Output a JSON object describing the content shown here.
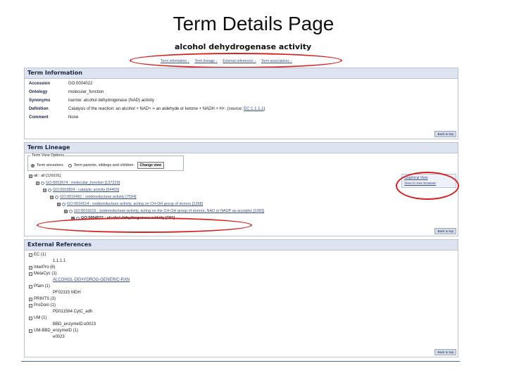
{
  "slide_title": "Term Details Page",
  "term_title": "alcohol dehydrogenase activity",
  "jump_links": [
    "Term information ↓",
    "Term lineage ↓",
    "External references ↓",
    "Term associations ↓"
  ],
  "back_to_top": "Back to top",
  "term_information": {
    "header": "Term Information",
    "rows": [
      {
        "key": "Accession",
        "value": "GO:0004022"
      },
      {
        "key": "Ontology",
        "value": "molecular_function"
      },
      {
        "key": "Synonyms",
        "value": "narrow: alcohol dehydrogenase (NAD) activity"
      },
      {
        "key": "Definition",
        "value": "Catalysis of the reaction: an alcohol + NAD+ = an aldehyde or ketone + NADH + H+. (source: ",
        "link": "EC:1.1.1.1",
        "suffix": ")"
      },
      {
        "key": "Comment",
        "value": "None"
      }
    ]
  },
  "term_lineage": {
    "header": "Term Lineage",
    "view_options": {
      "legend": "Term View Options",
      "option1": "Term ancestors",
      "option2": "Term parents, siblings and children",
      "button": "Change view"
    },
    "tree": [
      {
        "toggle": "⊟",
        "text": "all : all [129191]"
      },
      {
        "toggle": "⊟",
        "text": "GO:0003674 : molecular_function [137229]"
      },
      {
        "toggle": "⊟",
        "text": "GO:0003824 : catalytic activity [64400]"
      },
      {
        "toggle": "⊟",
        "text": "GO:0016491 : oxidoreductase activity [7594]"
      },
      {
        "toggle": "⊞",
        "text": "GO:0016614 : oxidoreductase activity, acting on CH-OH group of donors [1268]"
      },
      {
        "toggle": "⊞",
        "text": "GO:0016616 : oxidoreductase activity, acting on the CH-OH group of donors, NAD or NADP as acceptor [1083]"
      },
      {
        "toggle": "⊞",
        "text": "GO:0004022 : alcohol dehydrogenase activity [191]"
      }
    ],
    "views": [
      "Graphical View",
      "View in tree browser"
    ]
  },
  "external_references": {
    "header": "External References",
    "items": [
      {
        "db": "EC (1)",
        "sub": "1.1.1.1"
      },
      {
        "db": "InterPro (6)",
        "sub": ""
      },
      {
        "db": "MetaCyc (1)",
        "sub": "ALCOHOL-DEHYDROG-GENERIC-RXN"
      },
      {
        "db": "Pfam (1)",
        "sub": "PF02315 MDH"
      },
      {
        "db": "PRINTS (3)",
        "sub": ""
      },
      {
        "db": "ProDom (1)",
        "sub": "PD011584 CytC_adh"
      },
      {
        "db": "UM (1)",
        "sub": "BBD_enzymeID:e0023"
      },
      {
        "db": "UM-BBD_enzymeID (1)",
        "sub": "e0023"
      }
    ]
  },
  "colors": {
    "annotation_oval": "#d82020",
    "header_bg": "#dde4f0",
    "link": "#3a4f8a"
  }
}
